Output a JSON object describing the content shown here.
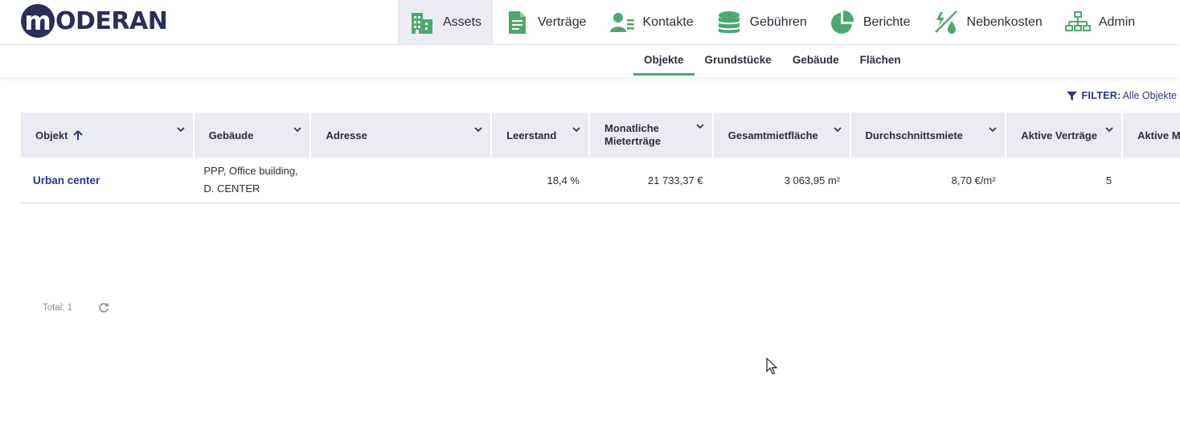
{
  "brand": {
    "logo_letter": "m",
    "logo_text": "ODERAN"
  },
  "main_nav": [
    {
      "label": "Assets",
      "icon": "building-icon",
      "active": true
    },
    {
      "label": "Verträge",
      "icon": "document-icon",
      "active": false
    },
    {
      "label": "Kontakte",
      "icon": "contacts-icon",
      "active": false
    },
    {
      "label": "Gebühren",
      "icon": "coins-icon",
      "active": false
    },
    {
      "label": "Berichte",
      "icon": "pie-chart-icon",
      "active": false
    },
    {
      "label": "Nebenkosten",
      "icon": "utilities-icon",
      "active": false
    },
    {
      "label": "Admin",
      "icon": "hierarchy-icon",
      "active": false
    }
  ],
  "sub_nav": [
    {
      "label": "Objekte",
      "active": true
    },
    {
      "label": "Grundstücke",
      "active": false
    },
    {
      "label": "Gebäude",
      "active": false
    },
    {
      "label": "Flächen",
      "active": false
    }
  ],
  "filter": {
    "label": "FILTER:",
    "value": "Alle Objekte"
  },
  "table": {
    "columns": [
      {
        "label": "Objekt",
        "sorted": "asc"
      },
      {
        "label": "Gebäude"
      },
      {
        "label": "Adresse"
      },
      {
        "label": "Leerstand"
      },
      {
        "label_line1": "Monatliche",
        "label_line2": "Mieterträge"
      },
      {
        "label": "Gesamtmietfläche"
      },
      {
        "label": "Durchschnittsmiete"
      },
      {
        "label": "Aktive Verträge"
      },
      {
        "label": "Aktive M"
      }
    ],
    "rows": [
      {
        "objekt": "Urban center",
        "gebaeude_line1": "PPP, Office building,",
        "gebaeude_line2": "D. CENTER",
        "adresse": "",
        "leerstand": "18,4 %",
        "mieterträge": "21 733,37 €",
        "gesamtmietflaeche": "3 063,95 m²",
        "durchschnittsmiete": "8,70 €/m²",
        "aktive_vertraege": "5",
        "aktive_m": ""
      }
    ]
  },
  "footer": {
    "total": "Total: 1"
  },
  "colors": {
    "brand": "#2b2e5a",
    "accent_green": "#4ea86e",
    "link_blue": "#2b3688",
    "header_bg": "#ebecf3"
  }
}
